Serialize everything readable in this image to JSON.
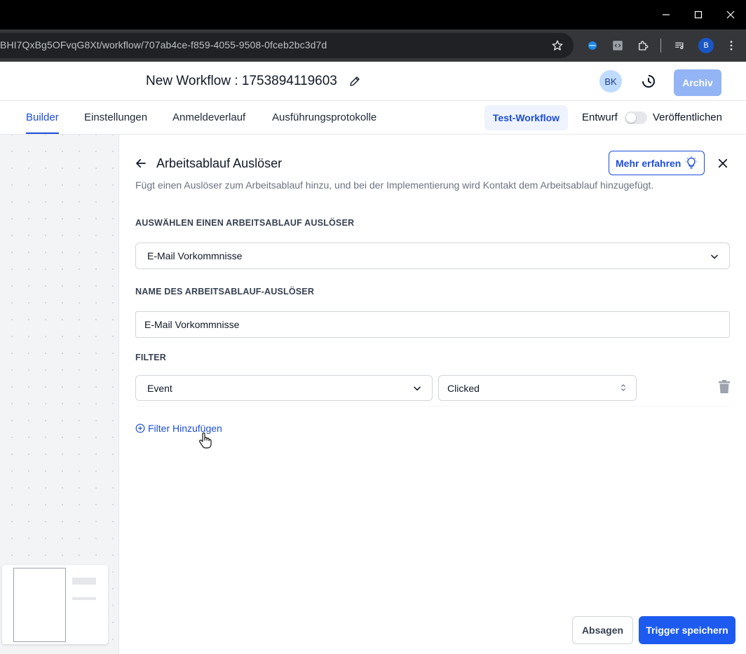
{
  "browser": {
    "url": "BHI7QxBg5OFvqG8Xt/workflow/707ab4ce-f859-4055-9508-0fceb2bc3d7d",
    "profile_initial": "B"
  },
  "header": {
    "workflow_title": "New Workflow : 1753894119603",
    "avatar_initials": "BK",
    "archive_label": "Archiv"
  },
  "tabs": [
    {
      "label": "Builder"
    },
    {
      "label": "Einstellungen"
    },
    {
      "label": "Anmeldeverlauf"
    },
    {
      "label": "Ausführungsprotokolle"
    }
  ],
  "toolbar": {
    "test_label": "Test-Workflow",
    "draft_label": "Entwurf",
    "publish_label": "Veröffentlichen"
  },
  "drawer": {
    "title": "Arbeitsablauf Auslöser",
    "learn_more": "Mehr erfahren",
    "description": "Fügt einen Auslöser zum Arbeitsablauf hinzu, und bei der Implementierung wird Kontakt dem Arbeitsablauf hinzugefügt.",
    "trigger_select_label": "AUSWÄHLEN EINEN ARBEITSABLAUF AUSLÖSER",
    "trigger_select_value": "E-Mail Vorkommnisse",
    "trigger_name_label": "NAME DES ARBEITSABLAUF-AUSLÖSER",
    "trigger_name_value": "E-Mail Vorkommnisse",
    "filter_label": "FILTER",
    "filter_field": "Event",
    "filter_value": "Clicked",
    "add_filter": "Filter Hinzufügen",
    "cancel_label": "Absagen",
    "save_label": "Trigger speichern"
  },
  "colors": {
    "accent": "#1d4ed8",
    "primary_button": "#1d5bf0",
    "archive_disabled": "#93b4f5"
  }
}
